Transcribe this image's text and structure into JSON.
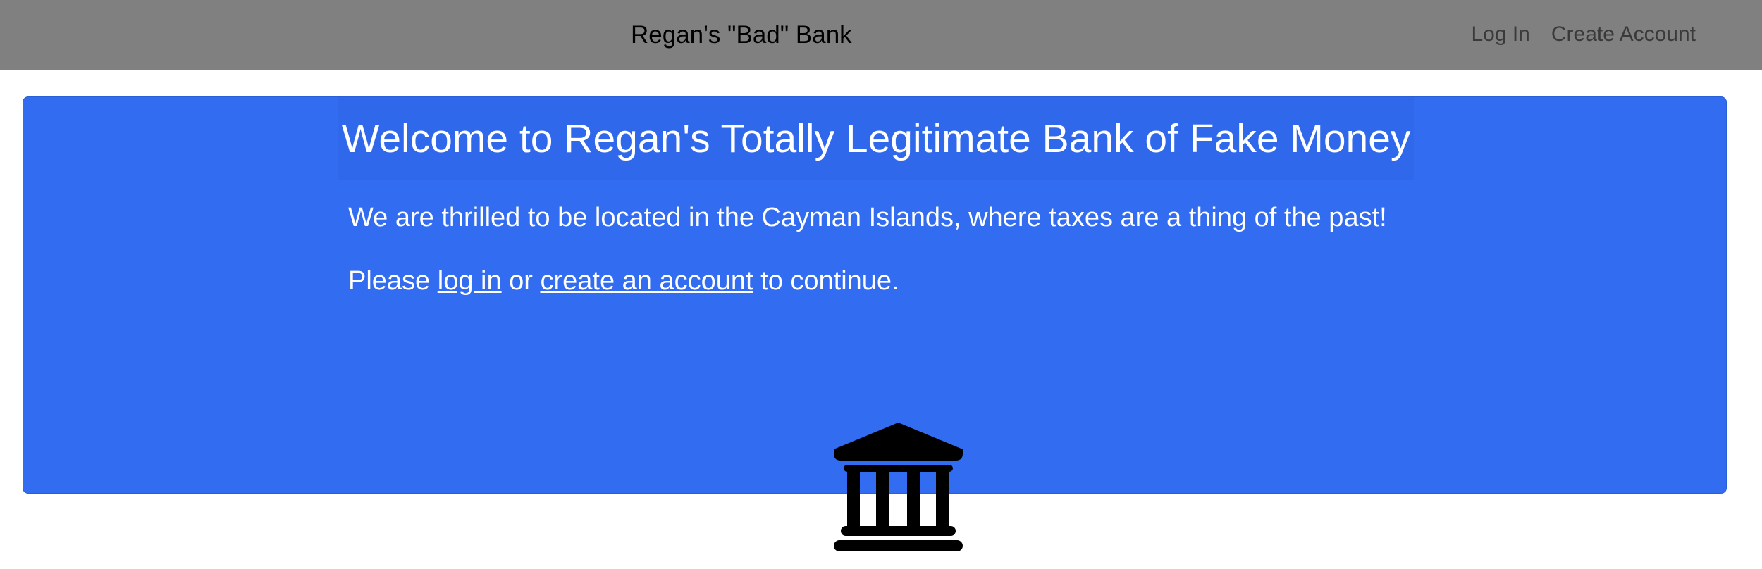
{
  "navbar": {
    "brand": "Regan's \"Bad\" Bank",
    "links": [
      {
        "label": "Log In"
      },
      {
        "label": "Create Account"
      }
    ]
  },
  "card": {
    "title": "Welcome to Regan's Totally Legitimate Bank of Fake Money",
    "tagline": "We are thrilled to be located in the Cayman Islands, where taxes are a thing of the past!",
    "prompt": {
      "prefix": "Please ",
      "login_link": "log in",
      "middle": " or ",
      "create_link": "create an account",
      "suffix": " to continue."
    },
    "icon": "bank-building-icon"
  },
  "colors": {
    "navbar_bg": "#808080",
    "card_bg": "#326df1",
    "text_on_card": "#ffffff"
  }
}
